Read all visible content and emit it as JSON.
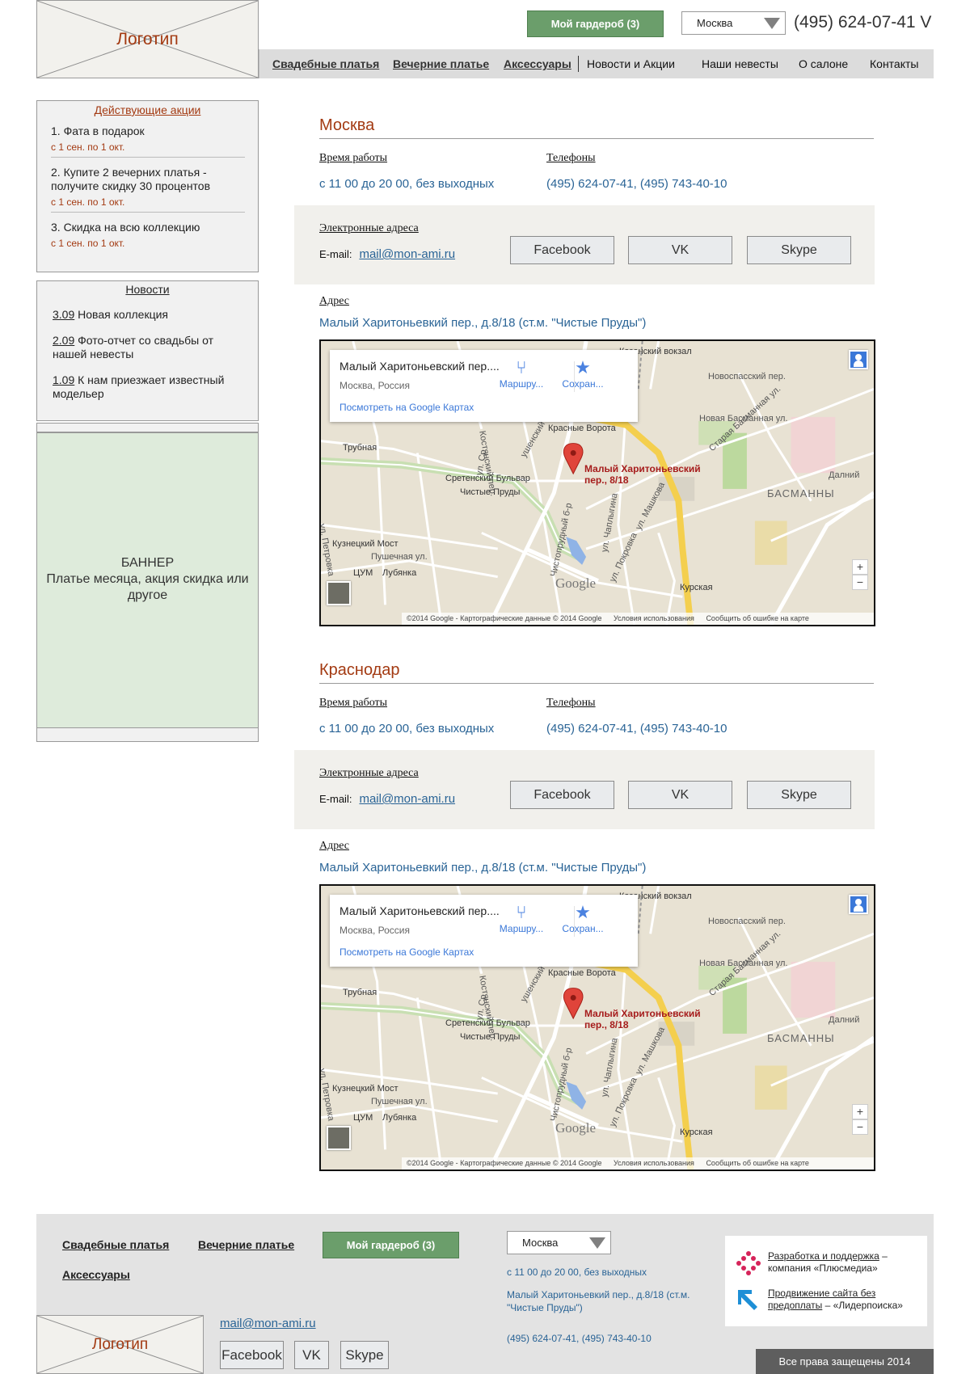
{
  "header": {
    "logo_text": "Логотип",
    "wardrobe_button": "Мой гардероб (3)",
    "city_select": "Москва",
    "phone": "(495) 624-07-41 V"
  },
  "nav": {
    "items": [
      {
        "label": "Свадебные платья",
        "underlined": true
      },
      {
        "label": "Вечерние платье",
        "underlined": true
      },
      {
        "label": "Аксессуары",
        "underlined": true
      },
      {
        "label": "Новости и Акции",
        "underlined": false
      },
      {
        "label": "Наши невесты",
        "underlined": false
      },
      {
        "label": "О салоне",
        "underlined": false
      },
      {
        "label": "Контакты",
        "underlined": false
      }
    ]
  },
  "sidebar": {
    "promos": {
      "title": "Действующие акции",
      "items": [
        {
          "text": "1. Фата в подарок",
          "date": "с 1 сен. по 1 окт."
        },
        {
          "text": "2. Купите 2 вечерних платья - получите скидку 30 процентов",
          "date": "с 1 сен. по 1 окт."
        },
        {
          "text": "3. Скидка на всю коллекцию",
          "date": "с 1 сен. по 1 окт."
        }
      ]
    },
    "news": {
      "title": "Новости",
      "items": [
        {
          "date": "3.09",
          "text": "Новая коллекция"
        },
        {
          "date": "2.09",
          "text": "Фото-отчет со свадьбы от нашей невесты"
        },
        {
          "date": "1.09",
          "text": "К нам приезжает известный модельер"
        }
      ]
    },
    "banner": {
      "title": "БАННЕР",
      "text": "Платье месяца, акция скидка или другое"
    }
  },
  "cities": [
    {
      "name": "Москва",
      "hours_label": "Время работы",
      "hours": "с 11 00 до 20 00, без выходных",
      "phones_label": "Телефоны",
      "phones": "(495) 624-07-41, (495) 743-40-10",
      "emails_label": "Электронные адреса",
      "email_prefix": "E-mail:",
      "email": "mail@mon-ami.ru",
      "social": [
        "Facebook",
        "VK",
        "Skype"
      ],
      "address_label": "Адрес",
      "address": "Малый Харитоньевкий пер., д.8/18 (ст.м. \"Чистые Пруды\")"
    },
    {
      "name": "Краснодар",
      "hours_label": "Время работы",
      "hours": "с 11 00 до 20 00, без выходных",
      "phones_label": "Телефоны",
      "phones": "(495) 624-07-41, (495) 743-40-10",
      "emails_label": "Электронные адреса",
      "email_prefix": "E-mail:",
      "email": "mail@mon-ami.ru",
      "social": [
        "Facebook",
        "VK",
        "Skype"
      ],
      "address_label": "Адрес",
      "address": "Малый Харитоньевкий пер., д.8/18 (ст.м. \"Чистые Пруды\")"
    }
  ],
  "map": {
    "card_title": "Малый Харитоньевский пер....",
    "card_subtitle": "Москва, Россия",
    "card_link": "Посмотреть на Google Картах",
    "route_label": "Маршру...",
    "save_label": "Сохран...",
    "pin_label": "Малый Харитоньевский пер., 8/18",
    "labels": {
      "kazansky": "Казанский вокзал",
      "novospassky": "Новоспасский пер.",
      "novaya_basmannaya": "Новая Басманная ул.",
      "krasnye_vorota": "Красные Ворота",
      "trubnaya": "Трубная",
      "sretensky": "Сретенский Бульвар",
      "chistye_prudy": "Чистые Пруды",
      "kuznetsky": "Кузнецкий Мост",
      "pushechnaya": "Пушечная ул.",
      "tsum": "ЦУМ",
      "lubyanka": "Лубянка",
      "kurskaya": "Курская",
      "staraya_basmannaya": "Старая Басманная ул.",
      "dalniy": "Далний",
      "basmanny": "БАСМАННЫ",
      "mashkova": "ул. Машкова",
      "chaplygina": "ул. Чаплыгина",
      "pokrovka": "ул. Покровка",
      "chistoprudny": "Чистопрудный б-р",
      "petrovka": "ул. Петровка",
      "sr": "ул. Ср",
      "kostyansky": "Костянский пер.",
      "gusyatnikov": "ушенский пер."
    },
    "google_logo": "Google",
    "attribution": [
      "©2014 Google - Картографические данные © 2014 Google",
      "Условия использования",
      "Сообщить об ошибке на карте"
    ],
    "zoom_in": "+",
    "zoom_out": "−"
  },
  "footer": {
    "links": [
      "Свадебные платья",
      "Вечерние платье",
      "Аксессуары"
    ],
    "wardrobe_button": "Мой гардероб (3)",
    "city_select": "Москва",
    "hours": "с 11 00 до 20 00, без выходных",
    "address": "Малый Харитоньевкий пер., д.8/18 (ст.м. \"Чистые Пруды\")",
    "phones": "(495) 624-07-41, (495) 743-40-10",
    "logo_text": "Логотип",
    "email": "mail@mon-ami.ru",
    "social": [
      "Facebook",
      "VK",
      "Skype"
    ],
    "credits": [
      {
        "link": "Разработка и поддержка",
        "text": " – компания «Плюсмедиа»"
      },
      {
        "link": "Продвижение сайта без предоплаты",
        "text": " – «Лидерпоиска»"
      }
    ],
    "copyright": "Все права защещены 2014"
  },
  "colors": {
    "accent_red": "#a33a12",
    "link_blue": "#2a6496",
    "wardrobe_green": "#6b9e6b",
    "banner_green": "#deebdb",
    "nav_gray": "#dcdcdc",
    "panel_gray": "#f1f1f1"
  },
  "icons": [
    "logo-placeholder-x-icon",
    "dropdown-triangle-icon",
    "map-pin-icon",
    "route-icon",
    "star-icon",
    "pegman-icon",
    "plusmedia-logo-icon",
    "liderpoiska-logo-icon"
  ]
}
